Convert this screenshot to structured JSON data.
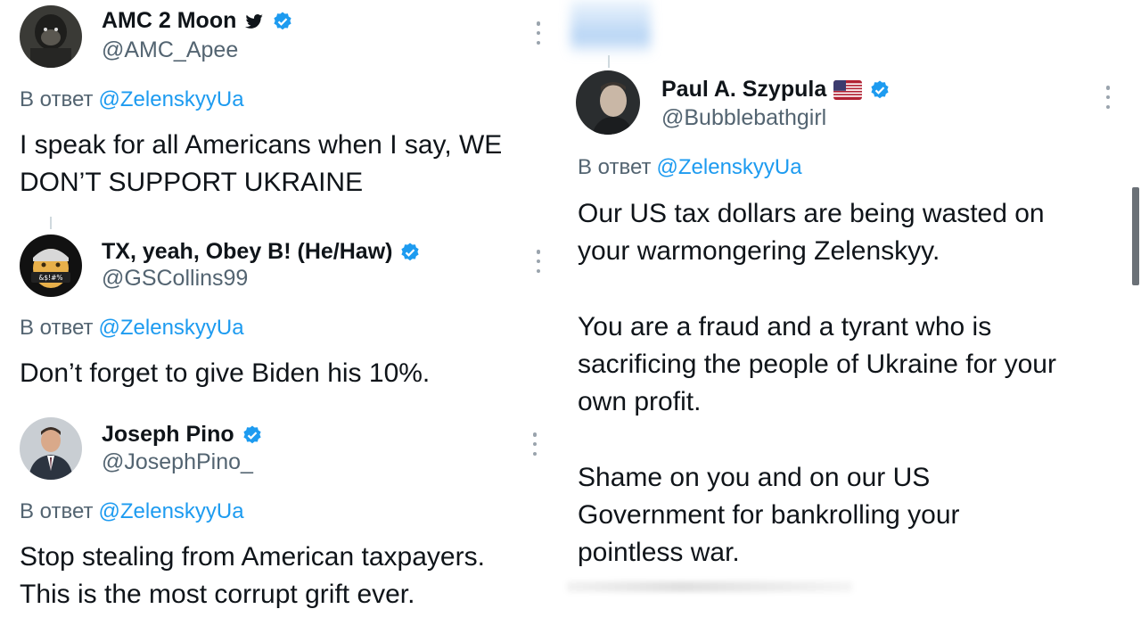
{
  "colors": {
    "accent": "#1d9bf0",
    "secondary_text": "#536471",
    "primary_text": "#0f1419"
  },
  "tweets_left": [
    {
      "name": "AMC 2 Moon",
      "handle": "@AMC_Apee",
      "reply_prefix": "В ответ",
      "reply_to": "@ZelenskyyUa",
      "lines": [
        "I speak for all Americans when I say, WE",
        "DON’T SUPPORT UKRAINE"
      ],
      "icons": [
        "twitter-bird-icon",
        "verified-badge-icon"
      ]
    },
    {
      "name": "TX, yeah, Obey B! (He/Haw)",
      "handle": "@GSCollins99",
      "reply_prefix": "В ответ",
      "reply_to": "@ZelenskyyUa",
      "lines": [
        "Don’t forget to give Biden his 10%."
      ],
      "avatar_text": "&$!#%",
      "icons": [
        "verified-badge-icon"
      ]
    },
    {
      "name": "Joseph Pino",
      "handle": "@JosephPino_",
      "reply_prefix": "В ответ",
      "reply_to": "@ZelenskyyUa",
      "lines": [
        "Stop stealing from American taxpayers.",
        "This is the most corrupt grift ever."
      ],
      "icons": [
        "verified-badge-icon"
      ]
    }
  ],
  "tweet_right": {
    "name": "Paul A. Szypula",
    "flag": "🇺🇸",
    "handle": "@Bubblebathgirl",
    "reply_prefix": "В ответ",
    "reply_to": "@ZelenskyyUa",
    "paragraphs": [
      [
        "Our US tax dollars are being wasted on",
        "your warmongering Zelenskyy."
      ],
      [
        "You are a fraud and a tyrant who is",
        "sacrificing the people of Ukraine for your",
        "own profit."
      ],
      [
        "Shame on you and on our US",
        "Government for bankrolling your",
        "pointless war."
      ]
    ],
    "icons": [
      "us-flag-icon",
      "verified-badge-icon"
    ]
  }
}
